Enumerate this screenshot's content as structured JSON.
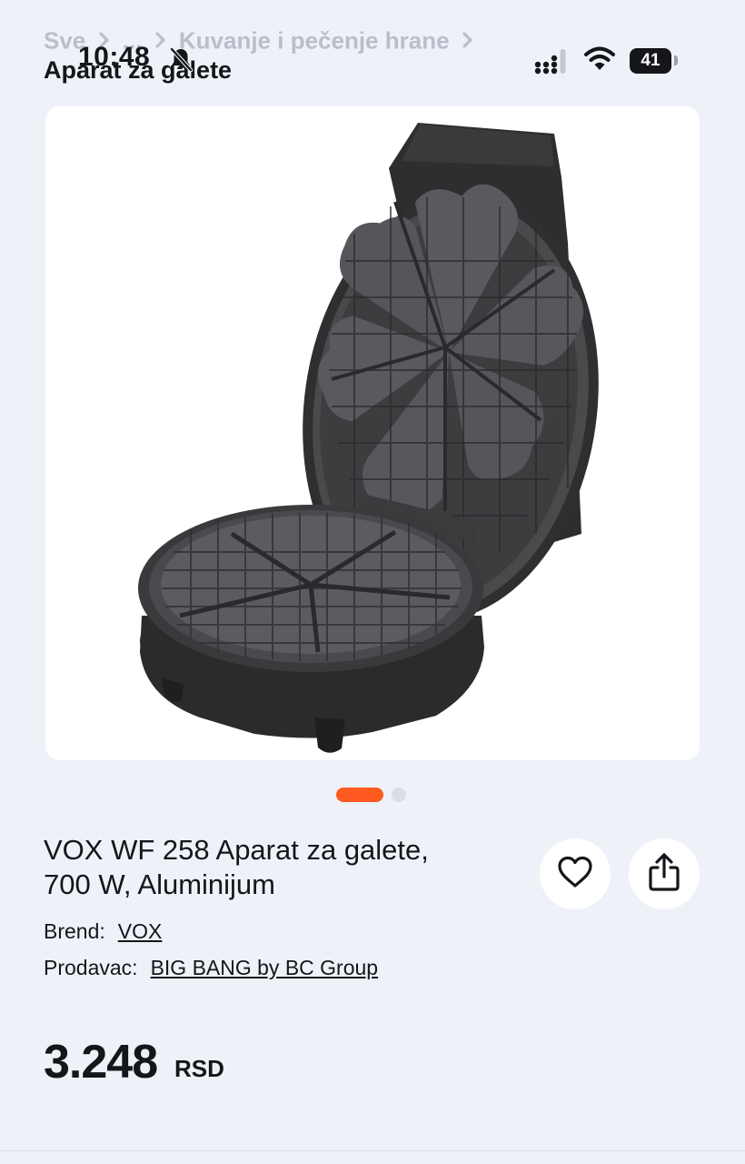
{
  "breadcrumb": {
    "items": [
      "Sve",
      "...",
      "Kuvanje i pečenje hrane"
    ]
  },
  "page_title": "Aparat za galete",
  "status_bar": {
    "time": "10:48",
    "battery": "41",
    "icons": [
      "bell-muted-icon",
      "cellular-signal-icon",
      "wifi-icon",
      "battery-icon"
    ]
  },
  "image": {
    "subject": "waffle-maker-photo",
    "carousel_total": 2,
    "carousel_active": 1
  },
  "product": {
    "name_line1": "VOX WF 258 Aparat za galete,",
    "name_line2": "700 W, Aluminijum",
    "brand_label": "Brend:",
    "brand_value": "VOX",
    "seller_label": "Prodavac:",
    "seller_value": "BIG BANG by BC Group",
    "price": "3.248",
    "currency": "RSD"
  },
  "actions": {
    "favorite_icon": "heart-icon",
    "share_icon": "share-icon"
  },
  "colors": {
    "accent": "#ff5a1f",
    "background": "#eef2f8",
    "text": "#15161a"
  }
}
